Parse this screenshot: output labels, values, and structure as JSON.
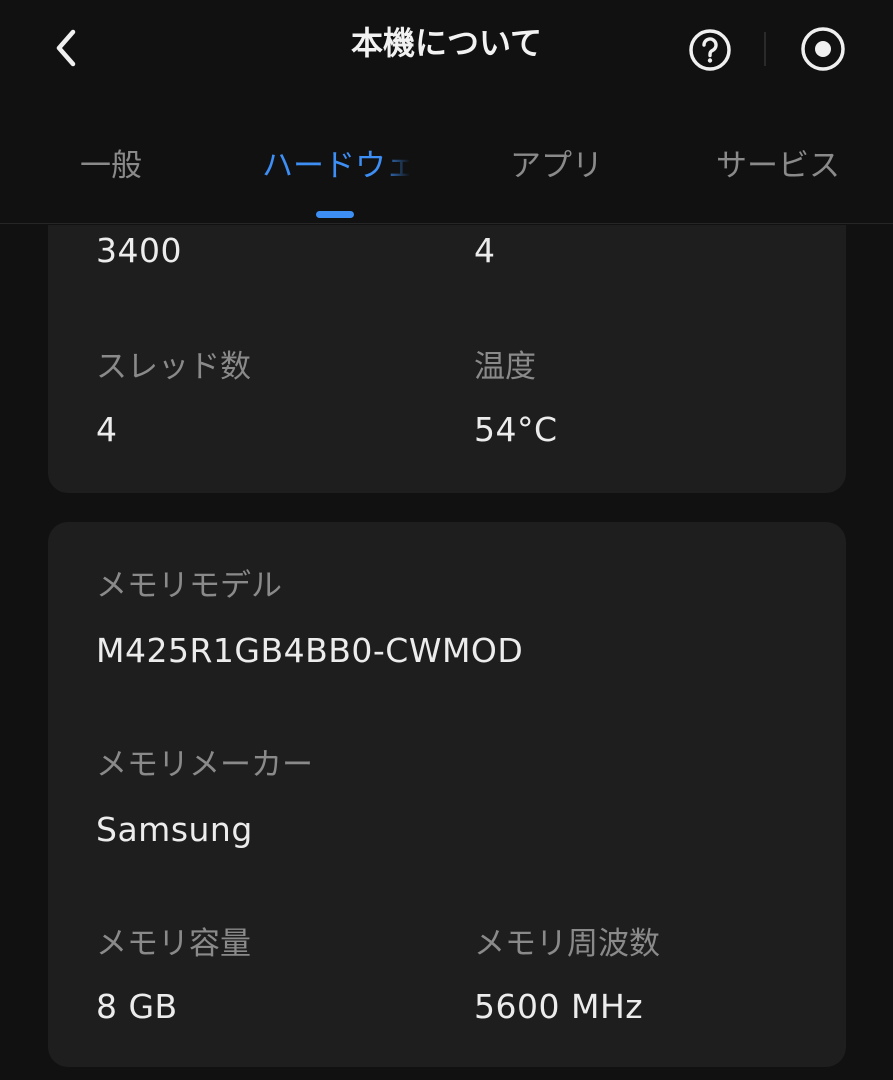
{
  "header": {
    "title": "本機について"
  },
  "tabs": [
    {
      "label": "一般",
      "active": false
    },
    {
      "label": "ハードウェア",
      "active": true
    },
    {
      "label": "アプリ",
      "active": false
    },
    {
      "label": "サービス",
      "active": false
    }
  ],
  "cpu_card": {
    "items": [
      {
        "value": "3400"
      },
      {
        "value": "4"
      },
      {
        "label": "スレッド数",
        "value": "4"
      },
      {
        "label": "温度",
        "value": "54°C"
      }
    ]
  },
  "memory_card": {
    "model": {
      "label": "メモリモデル",
      "value": "M425R1GB4BB0-CWMOD"
    },
    "maker": {
      "label": "メモリメーカー",
      "value": "Samsung"
    },
    "capacity": {
      "label": "メモリ容量",
      "value": "8 GB"
    },
    "frequency": {
      "label": "メモリ周波数",
      "value": "5600 MHz"
    }
  },
  "colors": {
    "background": "#111111",
    "card": "#1e1e1e",
    "accent": "#3d8ef5",
    "label": "#8a8a8a",
    "value": "#ececec"
  },
  "icons": {
    "back": "chevron-left-icon",
    "help": "question-circle-icon",
    "record": "record-circle-icon"
  }
}
